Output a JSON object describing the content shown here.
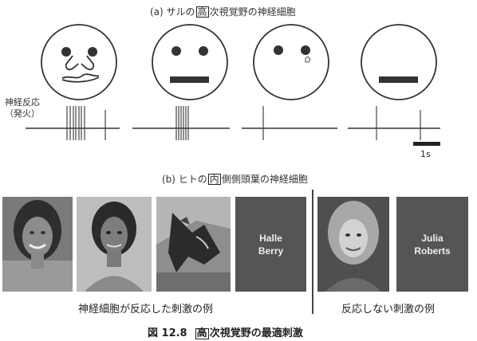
{
  "panel_a": {
    "title_pre": "(a) サルの",
    "title_box": "高",
    "title_post": "次視覚野の神経細胞",
    "response_label_line1": "神経反応",
    "response_label_line2": "（発火）",
    "scale_label": "1s",
    "stimuli": [
      {
        "description": "full face with eyes, nose, mouth",
        "spike_count": 7
      },
      {
        "description": "eyes and bar mouth",
        "spike_count": 6
      },
      {
        "description": "eyes only",
        "spike_count": 1
      },
      {
        "description": "bar mouth only",
        "spike_count": 1
      }
    ]
  },
  "panel_b": {
    "title_pre": "(b) ヒトの",
    "title_box": "内",
    "title_post": "側側頭葉の神経細胞",
    "card_halle": {
      "line1": "Halle",
      "line2": "Berry"
    },
    "card_julia": {
      "line1": "Julia",
      "line2": "Roberts"
    },
    "caption_responded": "神経細胞が反応した刺激の例",
    "caption_not_responded": "反応しない刺激の例"
  },
  "figure_caption": {
    "number": "図 12.8",
    "box": "高",
    "text": "次視覚野の最適刺激"
  }
}
